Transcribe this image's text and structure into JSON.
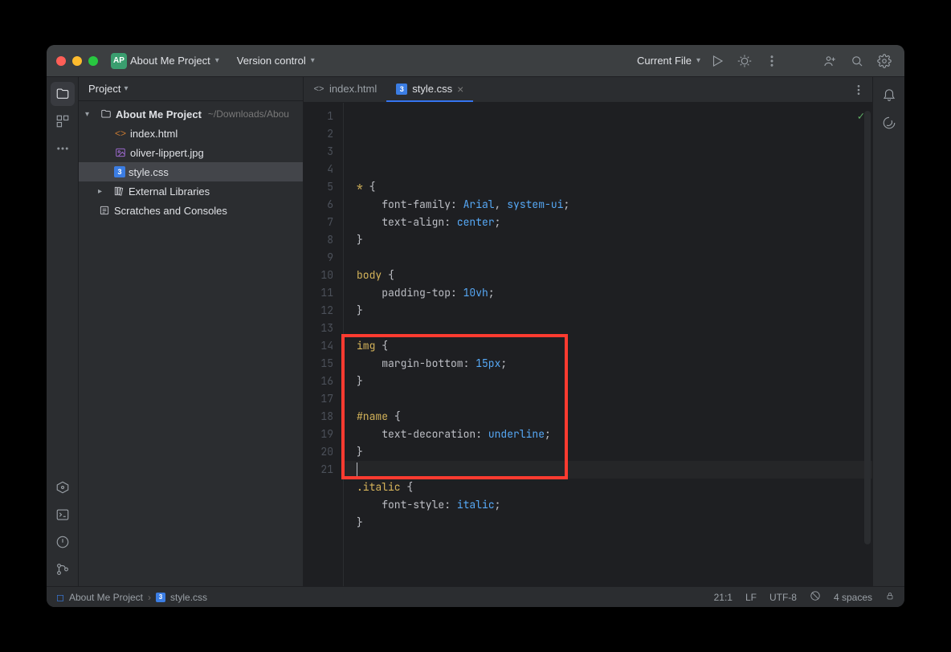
{
  "titlebar": {
    "project_short": "AP",
    "project_name": "About Me Project",
    "version_control": "Version control",
    "current_file": "Current File"
  },
  "sidebar": {
    "header": "Project",
    "tree": {
      "root_name": "About Me Project",
      "root_path": "~/Downloads/Abou",
      "files": [
        {
          "name": "index.html",
          "type": "html"
        },
        {
          "name": "oliver-lippert.jpg",
          "type": "img"
        },
        {
          "name": "style.css",
          "type": "css"
        }
      ],
      "external": "External Libraries",
      "scratches": "Scratches and Consoles"
    }
  },
  "tabs": [
    {
      "name": "index.html",
      "type": "html",
      "active": false
    },
    {
      "name": "style.css",
      "type": "css",
      "active": true
    }
  ],
  "code": {
    "lines": [
      {
        "n": 1,
        "t": [
          [
            "sel",
            "*"
          ],
          [
            "punct",
            " {"
          ]
        ]
      },
      {
        "n": 2,
        "t": [
          [
            "plain",
            "    font-family: "
          ],
          [
            "name",
            "Arial"
          ],
          [
            "punct",
            ", "
          ],
          [
            "val",
            "system-ui"
          ],
          [
            "punct",
            ";"
          ]
        ]
      },
      {
        "n": 3,
        "t": [
          [
            "plain",
            "    text-align: "
          ],
          [
            "val",
            "center"
          ],
          [
            "punct",
            ";"
          ]
        ]
      },
      {
        "n": 4,
        "t": [
          [
            "punct",
            "}"
          ]
        ]
      },
      {
        "n": 5,
        "t": []
      },
      {
        "n": 6,
        "t": [
          [
            "sel",
            "body"
          ],
          [
            "punct",
            " {"
          ]
        ]
      },
      {
        "n": 7,
        "t": [
          [
            "plain",
            "    padding-top: "
          ],
          [
            "num",
            "10vh"
          ],
          [
            "punct",
            ";"
          ]
        ]
      },
      {
        "n": 8,
        "t": [
          [
            "punct",
            "}"
          ]
        ]
      },
      {
        "n": 9,
        "t": []
      },
      {
        "n": 10,
        "t": [
          [
            "sel",
            "img"
          ],
          [
            "punct",
            " {"
          ]
        ]
      },
      {
        "n": 11,
        "t": [
          [
            "plain",
            "    margin-bottom: "
          ],
          [
            "num",
            "15px"
          ],
          [
            "punct",
            ";"
          ]
        ]
      },
      {
        "n": 12,
        "t": [
          [
            "punct",
            "}"
          ]
        ]
      },
      {
        "n": 13,
        "t": []
      },
      {
        "n": 14,
        "t": [
          [
            "sel",
            "#name"
          ],
          [
            "punct",
            " {"
          ]
        ]
      },
      {
        "n": 15,
        "t": [
          [
            "plain",
            "    text-decoration: "
          ],
          [
            "val",
            "underline"
          ],
          [
            "punct",
            ";"
          ]
        ]
      },
      {
        "n": 16,
        "t": [
          [
            "punct",
            "}"
          ]
        ]
      },
      {
        "n": 17,
        "t": []
      },
      {
        "n": 18,
        "t": [
          [
            "sel",
            ".italic"
          ],
          [
            "punct",
            " {"
          ]
        ]
      },
      {
        "n": 19,
        "t": [
          [
            "plain",
            "    font-style: "
          ],
          [
            "val",
            "italic"
          ],
          [
            "punct",
            ";"
          ]
        ]
      },
      {
        "n": 20,
        "t": [
          [
            "punct",
            "}"
          ]
        ]
      },
      {
        "n": 21,
        "t": []
      }
    ]
  },
  "status": {
    "crumb_project": "About Me Project",
    "crumb_file": "style.css",
    "cursor": "21:1",
    "line_ending": "LF",
    "encoding": "UTF-8",
    "indent": "4 spaces"
  },
  "annotation": {
    "highlight_lines": [
      14,
      20
    ]
  }
}
